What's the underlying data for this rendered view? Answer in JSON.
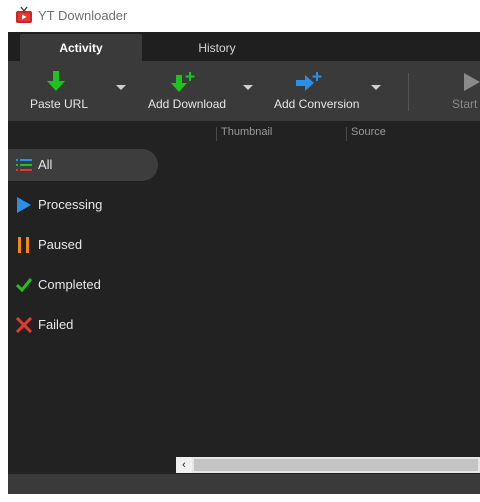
{
  "window": {
    "title": "YT Downloader"
  },
  "tabs": [
    {
      "label": "Activity",
      "active": true
    },
    {
      "label": "History",
      "active": false
    }
  ],
  "toolbar": {
    "paste_url": "Paste URL",
    "add_download": "Add Download",
    "add_conversion": "Add Conversion",
    "start": "Start"
  },
  "sidebar": {
    "items": [
      {
        "label": "All",
        "icon": "list-icon",
        "active": true
      },
      {
        "label": "Processing",
        "icon": "play-icon",
        "active": false
      },
      {
        "label": "Paused",
        "icon": "pause-icon",
        "active": false
      },
      {
        "label": "Completed",
        "icon": "check-icon",
        "active": false
      },
      {
        "label": "Failed",
        "icon": "x-icon",
        "active": false
      }
    ]
  },
  "list": {
    "columns": [
      "Thumbnail",
      "Source"
    ]
  },
  "colors": {
    "green": "#1ec31e",
    "blue": "#2b8fe3",
    "orange": "#f08a1c",
    "red": "#e23a2e"
  }
}
